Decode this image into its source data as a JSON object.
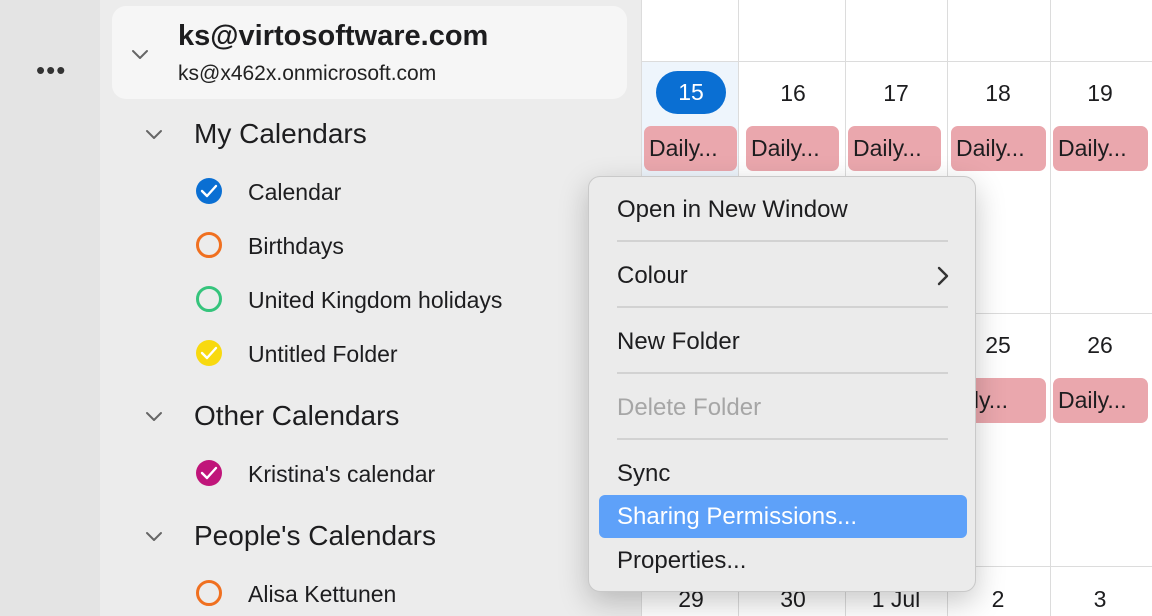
{
  "rail": {
    "more_label": "•••"
  },
  "account": {
    "name": "ks@virtosoftware.com",
    "email": "ks@x462x.onmicrosoft.com"
  },
  "groups": {
    "my": {
      "title": "My Calendars",
      "items": [
        {
          "label": "Calendar",
          "color": "#0a6fd3",
          "checked": true
        },
        {
          "label": "Birthdays",
          "color": "#f07020",
          "checked": false
        },
        {
          "label": "United Kingdom holidays",
          "color": "#35c47c",
          "checked": false
        },
        {
          "label": "Untitled Folder",
          "color": "#f8d90f",
          "checked": true
        }
      ]
    },
    "other": {
      "title": "Other Calendars",
      "items": [
        {
          "label": "Kristina's calendar",
          "color": "#c0157a",
          "checked": true
        }
      ]
    },
    "people": {
      "title": "People's Calendars",
      "items": [
        {
          "label": "Alisa Kettunen",
          "color": "#f07020",
          "checked": false
        }
      ]
    }
  },
  "calendar": {
    "week1": [
      "15",
      "16",
      "17",
      "18",
      "19"
    ],
    "today": "15",
    "event_label": "Daily...",
    "week2_visible": [
      "25",
      "26"
    ],
    "week2_partial_event": "aily...",
    "week3": [
      "29",
      "30",
      "1 Jul",
      "2",
      "3"
    ],
    "event_color": "#eaa7ad",
    "today_color": "#0a6fd3"
  },
  "context_menu": {
    "items": [
      {
        "label": "Open in New Window",
        "enabled": true
      },
      {
        "label": "Colour",
        "enabled": true,
        "submenu": true
      },
      {
        "label": "New Folder",
        "enabled": true
      },
      {
        "label": "Delete Folder",
        "enabled": false
      },
      {
        "label": "Sync",
        "enabled": true
      },
      {
        "label": "Sharing Permissions...",
        "enabled": true,
        "highlighted": true
      },
      {
        "label": "Properties...",
        "enabled": true
      }
    ],
    "highlight_color": "#5ea1f9"
  }
}
